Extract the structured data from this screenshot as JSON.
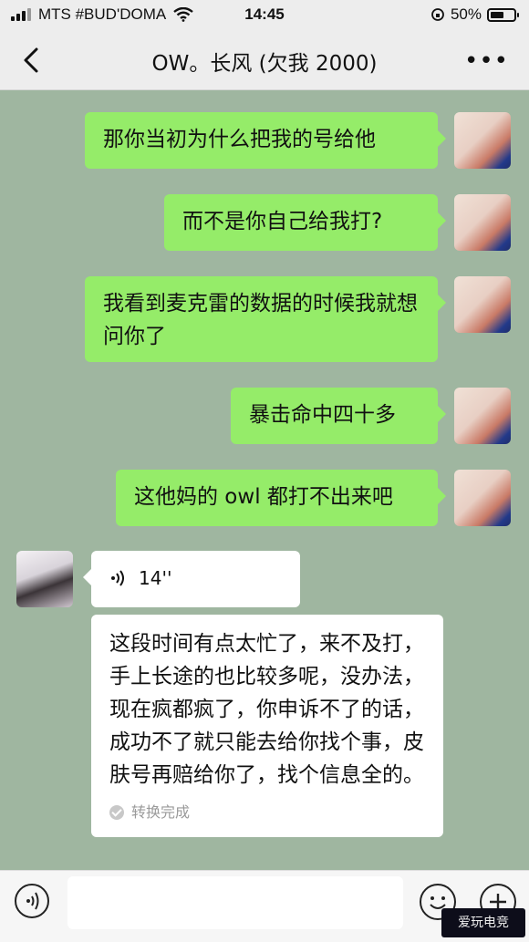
{
  "status_bar": {
    "carrier": "MTS #BUD'DOMA",
    "time": "14:45",
    "battery": "50%",
    "battery_level": 0.5
  },
  "header": {
    "title": "OW。长风 (欠我 2000)",
    "back_icon": "chevron-left-icon",
    "more_icon": "ellipsis-icon"
  },
  "messages": [
    {
      "side": "out",
      "text": "那你当初为什么把我的号给他"
    },
    {
      "side": "out",
      "text": "而不是你自己给我打?"
    },
    {
      "side": "out",
      "text": "我看到麦克雷的数据的时候我就想问你了"
    },
    {
      "side": "out",
      "text": "暴击命中四十多"
    },
    {
      "side": "out",
      "text": "这他妈的 owl 都打不出来吧"
    },
    {
      "side": "in",
      "type": "voice",
      "duration": "14''"
    },
    {
      "side": "in",
      "type": "transcript",
      "text": "这段时间有点太忙了，来不及打，手上长途的也比较多呢，没办法，现在疯都疯了，你申诉不了的话，成功不了就只能去给你找个事，皮肤号再赔给你了，找个信息全的。",
      "status": "转换完成"
    }
  ],
  "input_bar": {
    "voice_icon": "voice-icon",
    "emoji_icon": "emoji-icon",
    "plus_icon": "plus-icon"
  },
  "watermark": {
    "text": "爱玩电竞"
  },
  "colors": {
    "chat_background": "#9fb6a0",
    "outgoing_bubble": "#95ec69",
    "incoming_bubble": "#ffffff"
  }
}
